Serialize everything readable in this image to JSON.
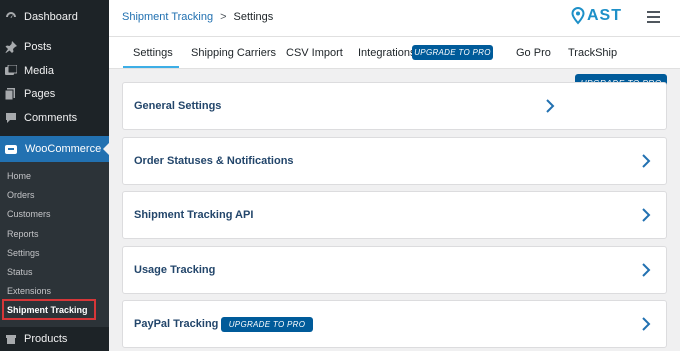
{
  "sidebar": {
    "top_items": [
      {
        "label": "Dashboard",
        "icon": "dashboard-icon"
      },
      {
        "label": "Posts",
        "icon": "pin-icon"
      },
      {
        "label": "Media",
        "icon": "media-icon"
      },
      {
        "label": "Pages",
        "icon": "pages-icon"
      },
      {
        "label": "Comments",
        "icon": "comment-icon"
      }
    ],
    "woocommerce": {
      "label": "WooCommerce",
      "icon": "woo-icon"
    },
    "submenu": [
      "Home",
      "Orders",
      "Customers",
      "Reports",
      "Settings",
      "Status",
      "Extensions",
      "Shipment Tracking"
    ],
    "products": {
      "label": "Products",
      "icon": "products-icon"
    }
  },
  "header": {
    "breadcrumb_link": "Shipment Tracking",
    "breadcrumb_sep": ">",
    "breadcrumb_current": "Settings",
    "logo_text": "AST"
  },
  "tabs": [
    {
      "label": "Settings"
    },
    {
      "label": "Shipping Carriers"
    },
    {
      "label": "CSV Import"
    },
    {
      "label": "Integrations"
    },
    {
      "label": "Go Pro"
    },
    {
      "label": "TrackShip"
    }
  ],
  "upgrade_label": "UPGRADE TO PRO",
  "cards": [
    {
      "title": "General Settings"
    },
    {
      "title": "Order Statuses & Notifications"
    },
    {
      "title": "Shipment Tracking API"
    },
    {
      "title": "Usage Tracking"
    },
    {
      "title": "PayPal Tracking"
    }
  ],
  "colors": {
    "accent": "#2271b1",
    "pro_badge": "#005b9a",
    "card_title": "#23466b",
    "sidebar": "#1d2327"
  }
}
